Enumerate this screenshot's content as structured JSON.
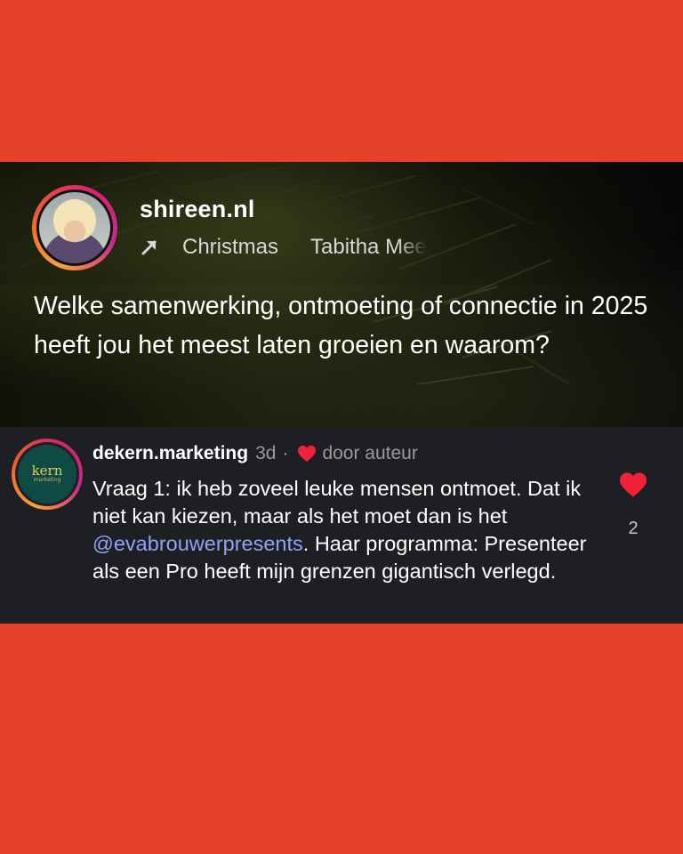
{
  "story": {
    "username": "shireen.nl",
    "music_title": "Christmas",
    "music_artist": "Tabitha Mee",
    "question": "Welke samenwerking, ontmoeting of connectie in 2025 heeft jou het meest laten groeien en waarom?"
  },
  "comment": {
    "username": "dekern.marketing",
    "time": "3d",
    "separator": "·",
    "liked_by_author_label": "door auteur",
    "text_before_mention": "Vraag 1: ik heb zoveel leuke mensen ontmoet. Dat ik niet kan kiezen, maar als het moet dan is het ",
    "mention": "@evabrouwerpresents",
    "text_after_mention": ". Haar programma: Presenteer als een Pro heeft mijn grenzen gigantisch verlegd.",
    "like_count": "2",
    "avatar_logo_text": "kern",
    "avatar_logo_subtext": "marketing"
  },
  "colors": {
    "background": "#E8412B",
    "heart": "#F2213B",
    "mention": "#8ea4f5",
    "comment_bg": "#1e1f23"
  },
  "icons": {
    "story_arrow": "arrow-up-right-icon",
    "like": "heart-icon"
  }
}
